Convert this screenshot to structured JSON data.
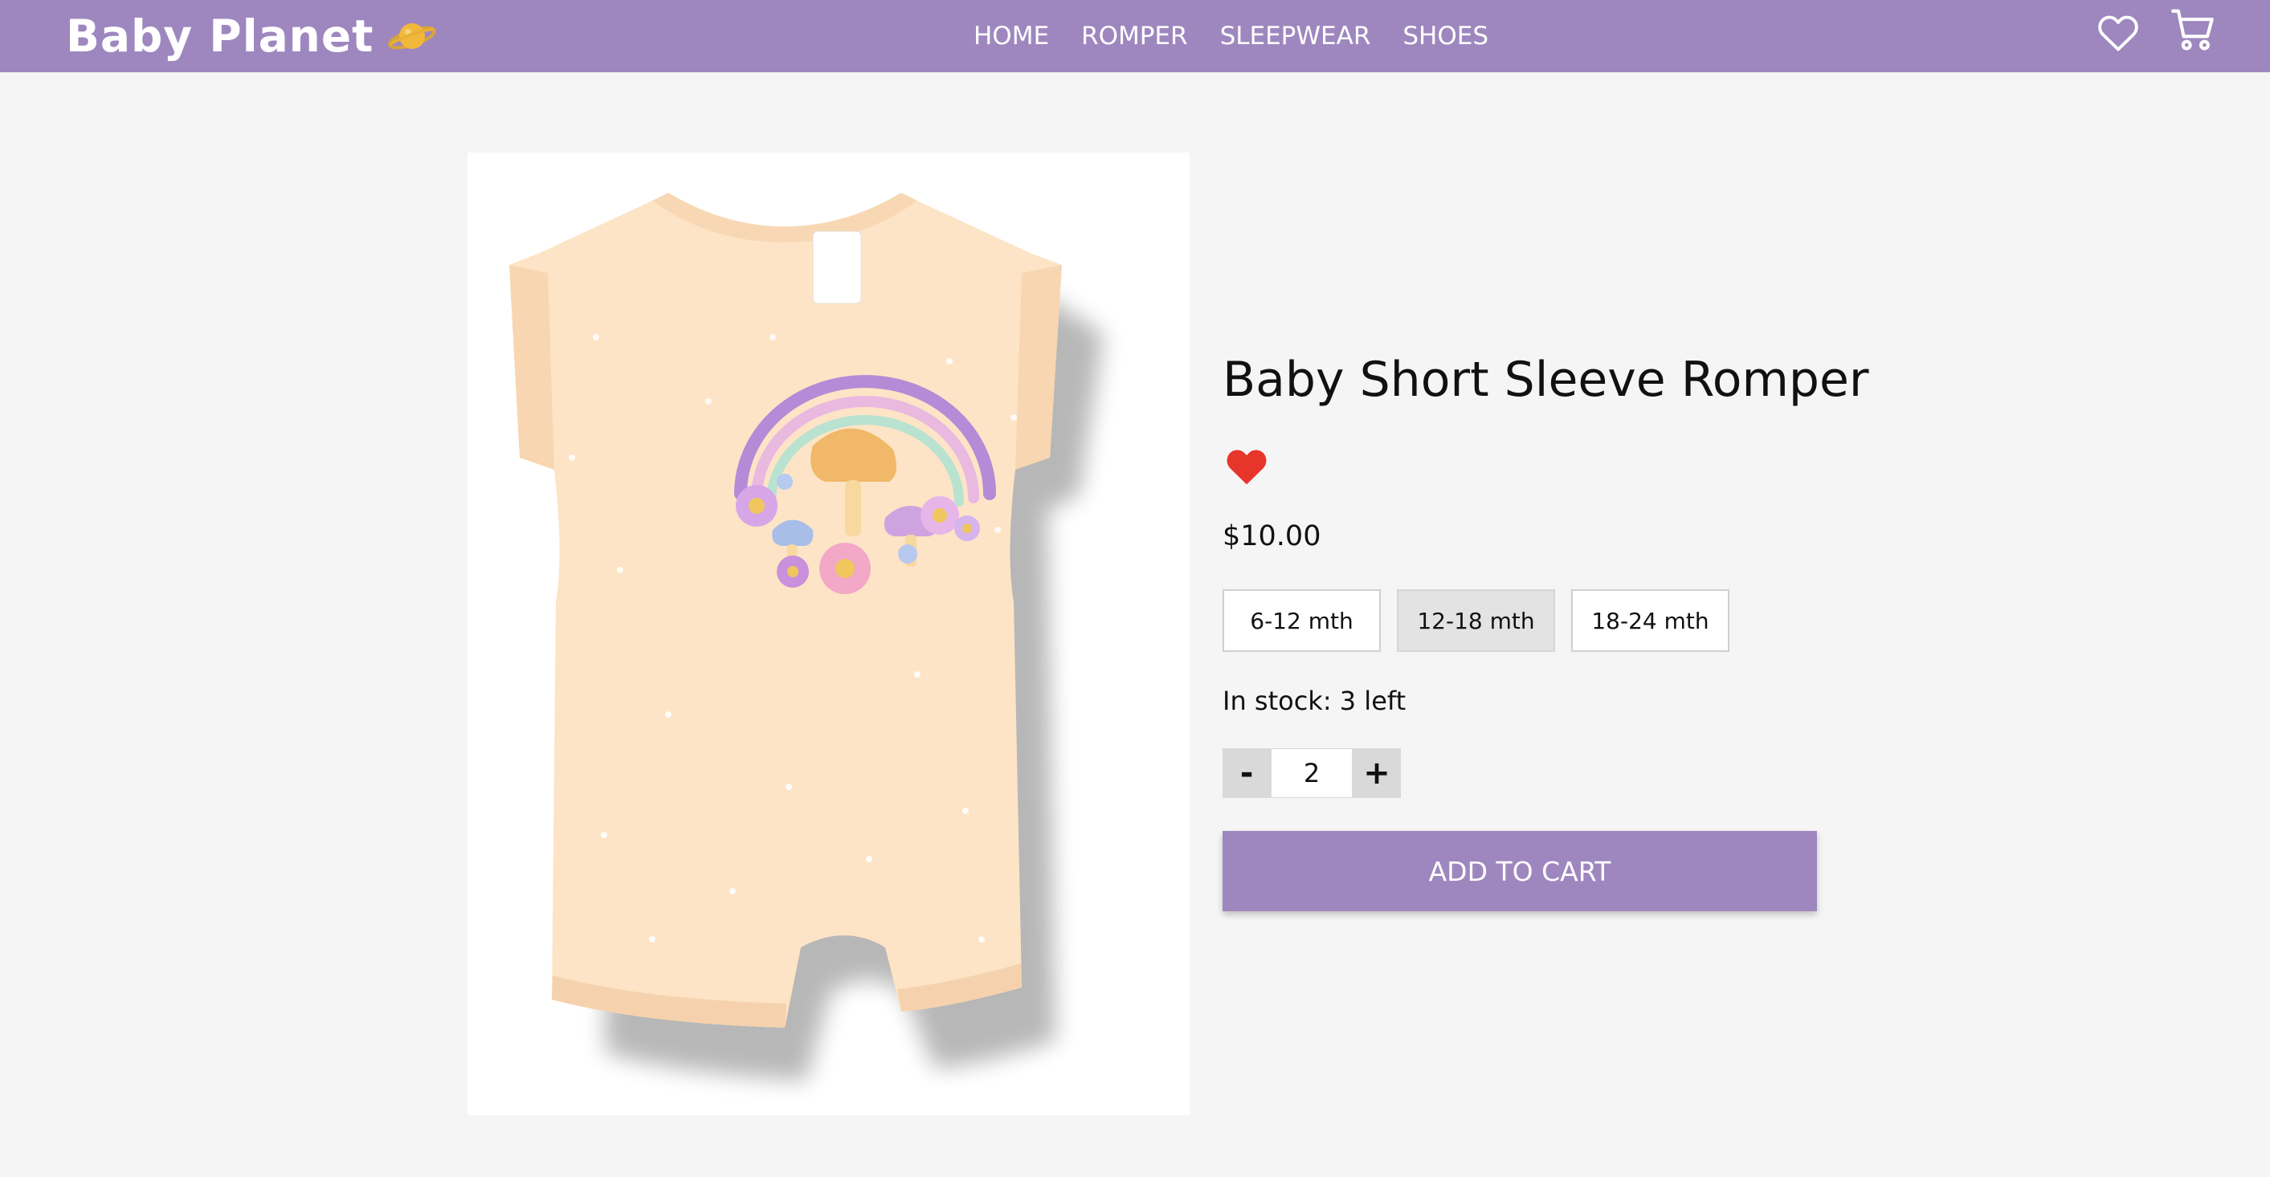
{
  "brand": {
    "name": "Baby Planet",
    "logo_icon": "planet-icon"
  },
  "nav": {
    "links": [
      "HOME",
      "ROMPER",
      "SLEEPWEAR",
      "SHOES"
    ],
    "wishlist_icon": "heart-outline-icon",
    "cart_icon": "cart-icon"
  },
  "product": {
    "image_alt": "Baby Short Sleeve Romper",
    "title": "Baby Short Sleeve Romper",
    "favorite_icon": "heart-filled-icon",
    "favorited": true,
    "price": "$10.00",
    "sizes": [
      {
        "label": "6-12 mth",
        "selected": false
      },
      {
        "label": "12-18 mth",
        "selected": true
      },
      {
        "label": "18-24 mth",
        "selected": false
      }
    ],
    "stock_text": "In stock: 3 left",
    "quantity": "2",
    "decrement_label": "-",
    "increment_label": "+",
    "add_to_cart_label": "ADD TO CART"
  },
  "colors": {
    "brand_purple": "#9e87bf",
    "background": "#f6f5f5",
    "heart_red": "#e8352b",
    "selected_size_bg": "#e4e3e3"
  }
}
